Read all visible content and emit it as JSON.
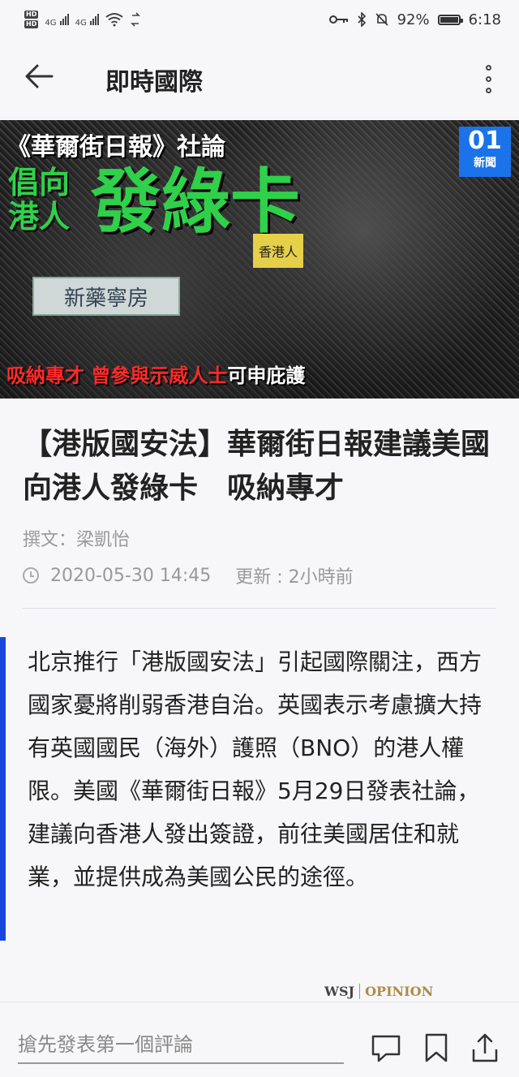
{
  "status_bar": {
    "hd1": "HD",
    "hd2": "HD",
    "net1": "4G",
    "net2": "4G",
    "battery": "92%",
    "battery_level": 0.92,
    "time": "6:18"
  },
  "header": {
    "title": "即時國際",
    "back_icon": "arrow-left-icon",
    "more_icon": "more-vertical-icon"
  },
  "hero": {
    "kicker": "《華爾街日報》社論",
    "big_small": "倡向港人",
    "big_large": "發綠卡",
    "banner": "香港人",
    "sign": "新藥寧房",
    "caption_red": "吸納專才 曾參與示威人士",
    "caption_white": "可申庇護",
    "logo_num": "01",
    "logo_label": "新聞"
  },
  "article": {
    "headline": "【港版國安法】華爾街日報建議美國向港人發綠卡　吸納專才",
    "author": "撰文：梁凱怡",
    "date": "2020-05-30 14:45",
    "updated": "更新 : 2小時前",
    "lead": "北京推行「港版國安法」引起國際關注，西方國家憂將削弱香港自治。英國表示考慮擴大持有英國國民（海外）護照（BNO）的港人權限。美國《華爾街日報》5月29日發表社論，建議向香港人發出簽證，前往美國居住和就業，並提供成為美國公民的途徑。"
  },
  "wsj": {
    "brand": "WSJ",
    "section": "OPINION"
  },
  "bottom_bar": {
    "comment_placeholder": "搶先發表第一個評論",
    "icons": [
      "comment-icon",
      "bookmark-icon",
      "share-icon"
    ]
  },
  "colors": {
    "accent": "#1a46e0",
    "headline_green": "#2fd04a",
    "caption_red": "#ff2a2a",
    "logo_blue": "#1a73e8"
  }
}
